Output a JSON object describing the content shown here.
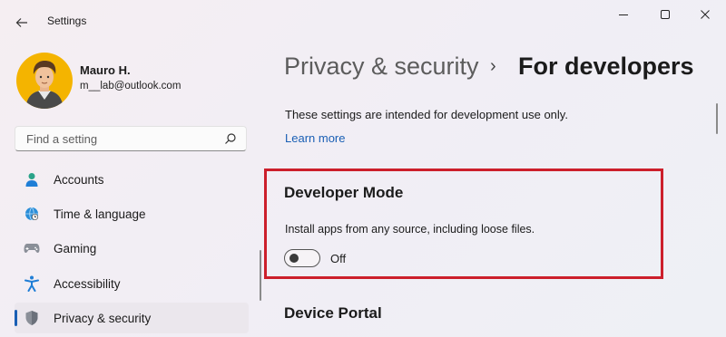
{
  "window": {
    "title": "Settings",
    "controls": [
      "minimize",
      "maximize",
      "close"
    ]
  },
  "profile": {
    "name": "Mauro H.",
    "email": "m__lab@outlook.com"
  },
  "search": {
    "placeholder": "Find a setting",
    "value": ""
  },
  "sidebar": {
    "items": [
      {
        "label": "Accounts",
        "icon": "accounts-icon",
        "selected": false
      },
      {
        "label": "Time & language",
        "icon": "globe-clock-icon",
        "selected": false
      },
      {
        "label": "Gaming",
        "icon": "gamepad-icon",
        "selected": false
      },
      {
        "label": "Accessibility",
        "icon": "accessibility-icon",
        "selected": false
      },
      {
        "label": "Privacy & security",
        "icon": "shield-icon",
        "selected": true
      }
    ]
  },
  "main": {
    "breadcrumb_parent": "Privacy & security",
    "breadcrumb_separator": "›",
    "page_title": "For developers",
    "intro": "These settings are intended for development use only.",
    "learn_more": "Learn more",
    "developer_mode": {
      "title": "Developer Mode",
      "description": "Install apps from any source, including loose files.",
      "toggle_state": "Off",
      "enabled": false
    },
    "device_portal": {
      "title": "Device Portal"
    }
  },
  "colors": {
    "accent": "#1a5fb4",
    "highlight_box": "#cc1f2b",
    "background": "#f3eff3"
  }
}
